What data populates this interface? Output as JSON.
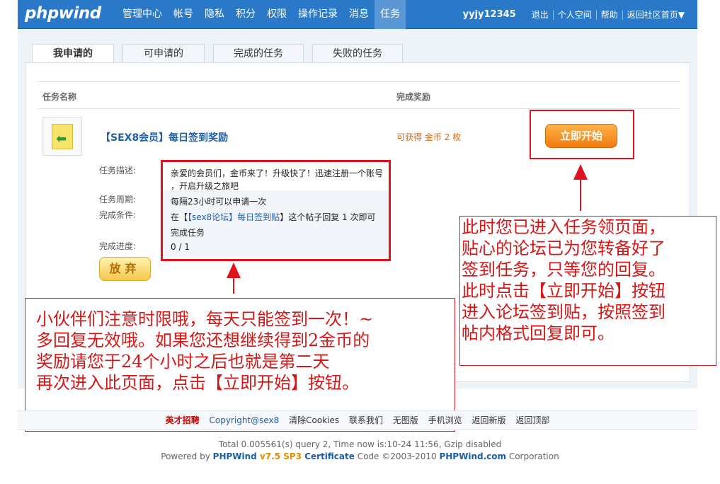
{
  "header": {
    "logo": "phpwind",
    "nav": [
      "管理中心",
      "帐号",
      "隐私",
      "积分",
      "权限",
      "操作记录",
      "消息",
      "任务"
    ],
    "username": "yyjy12345",
    "links": [
      "退出",
      "个人空间",
      "帮助",
      "返回社区首页▼"
    ]
  },
  "tabs": [
    "我申请的",
    "可申请的",
    "完成的任务",
    "失败的任务"
  ],
  "columns": {
    "name": "任务名称",
    "reward": "完成奖励"
  },
  "task": {
    "title": "【SEX8会员】每日签到奖励",
    "reward": "可获得 金币 2 枚",
    "start_label": "立即开始",
    "labels": {
      "desc": "任务描述:",
      "period": "任务周期:",
      "condition": "完成条件:",
      "progress": "完成进度:"
    },
    "desc_line1": "亲爱的会员们，金币来了！升级快了！迅速注册一个账号",
    "desc_line2": "，开启升级之旅吧",
    "period": "每隔23小时可以申请一次",
    "cond_pre": "在【",
    "cond_link": "【sex8论坛】每日签到贴",
    "cond_post": "】这个帖子回复 1 次即可",
    "cond_line2": "完成任务",
    "progress": "0 / 1",
    "quit_label": "放弃"
  },
  "annotations": {
    "right": [
      "此时您已进入任务领页面，",
      "贴心的论坛已为您转备好了",
      "签到任务，只等您的回复。",
      "此时点击【立即开始】按钮",
      "进入论坛签到贴，按照签到",
      "帖内格式回复即可。"
    ],
    "bottom": [
      "小伙伴们注意时限哦，每天只能签到一次！~",
      "多回复无效哦。如果您还想继续得到2金币的",
      "奖励请您于24个小时之后也就是第二天",
      "再次进入此页面，点击【立即开始】按钮。"
    ]
  },
  "footer": {
    "links": [
      "英才招聘",
      "Copyright@sex8",
      "清除Cookies",
      "联系我们",
      "无图版",
      "手机浏览",
      "返回新版",
      "返回顶部"
    ],
    "stats": "Total 0.005561(s) query 2, Time now is:10-24 11:56, Gzip disabled",
    "powered_pre": "Powered by ",
    "powered_brand": "PHPWind",
    "powered_ver": " v7.5 SP3 ",
    "powered_cert": "Certificate",
    "powered_mid": " Code ©2003-2010 ",
    "powered_site": "PHPWind.com",
    "powered_post": " Corporation"
  }
}
